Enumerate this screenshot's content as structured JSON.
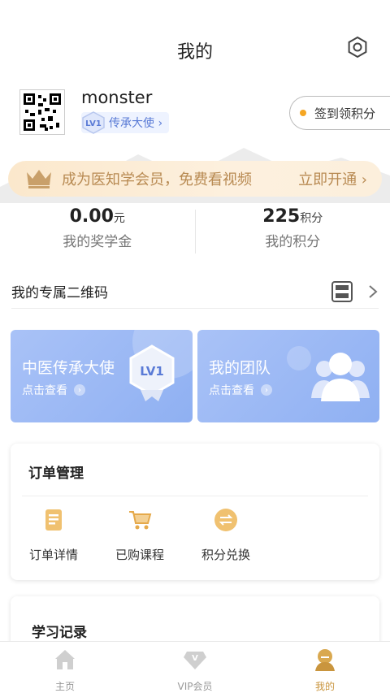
{
  "header": {
    "title": "我的",
    "settings_icon": "gear-icon"
  },
  "profile": {
    "username": "monster",
    "level": "LV1",
    "level_title": "传承大使 ›",
    "checkin_label": "签到领积分"
  },
  "vip_banner": {
    "text": "成为医知学会员，免费看视频",
    "action": "立即开通 ›"
  },
  "stats": {
    "scholarship_value": "0.00",
    "scholarship_unit": "元",
    "scholarship_label": "我的奖学金",
    "points_value": "225",
    "points_unit": "积分",
    "points_label": "我的积分"
  },
  "qr_row": {
    "label": "我的专属二维码"
  },
  "cards": {
    "ambassador": {
      "title": "中医传承大使",
      "sub": "点击查看",
      "badge": "LV1"
    },
    "team": {
      "title": "我的团队",
      "sub": "点击查看"
    }
  },
  "orders": {
    "title": "订单管理",
    "items": [
      {
        "label": "订单详情",
        "icon": "order-detail-icon"
      },
      {
        "label": "已购课程",
        "icon": "cart-icon"
      },
      {
        "label": "积分兑换",
        "icon": "exchange-icon"
      }
    ]
  },
  "study": {
    "title": "学习记录"
  },
  "tabbar": {
    "items": [
      {
        "label": "主页",
        "icon": "home-icon"
      },
      {
        "label": "VIP会员",
        "icon": "vip-icon"
      },
      {
        "label": "我的",
        "icon": "profile-icon"
      }
    ],
    "active_index": 2
  },
  "colors": {
    "accent": "#c9953e",
    "card_blue": "#8fb0f2",
    "vip_gold": "#b88a52"
  }
}
